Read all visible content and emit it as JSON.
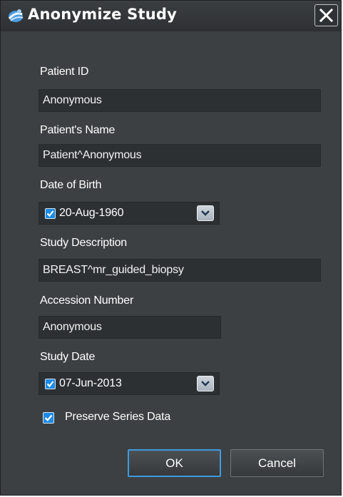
{
  "window": {
    "title": "Anonymize Study"
  },
  "fields": {
    "patient_id": {
      "label": "Patient ID",
      "value": "Anonymous"
    },
    "patient_name": {
      "label": "Patient's Name",
      "value": "Patient^Anonymous"
    },
    "date_of_birth": {
      "label": "Date of Birth",
      "value": "20-Aug-1960",
      "checked": true
    },
    "study_description": {
      "label": "Study Description",
      "value": "BREAST^mr_guided_biopsy"
    },
    "accession_number": {
      "label": "Accession Number",
      "value": "Anonymous"
    },
    "study_date": {
      "label": "Study Date",
      "value": "07-Jun-2013",
      "checked": true
    }
  },
  "preserve_series": {
    "label": "Preserve Series Data",
    "checked": true
  },
  "buttons": {
    "ok": "OK",
    "cancel": "Cancel"
  },
  "icons": {
    "app": "anonymize-app-icon",
    "close": "close-icon",
    "checkbox": "checkmark-icon",
    "dropdown": "chevron-down-icon"
  },
  "colors": {
    "dialog_bg": "#3d4042",
    "field_bg": "#2c3032",
    "accent": "#1b8ae6",
    "ok_focus": "#3e9be0"
  }
}
